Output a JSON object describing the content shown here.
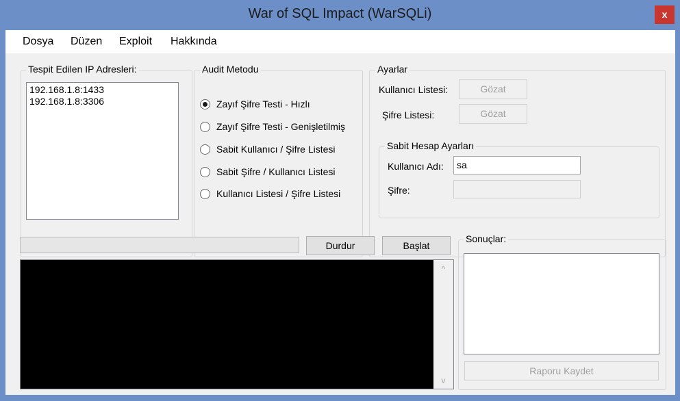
{
  "window": {
    "title": "War of SQL Impact (WarSQLi)",
    "close_glyph": "x"
  },
  "menu": {
    "items": [
      "Dosya",
      "Düzen",
      "Exploit",
      "Hakkında"
    ]
  },
  "ip_group": {
    "label": "Tespit Edilen IP Adresleri:",
    "items": [
      "192.168.1.8:1433",
      "192.168.1.8:3306"
    ]
  },
  "audit": {
    "label": "Audit Metodu",
    "options": [
      {
        "label": "Zayıf Şifre Testi - Hızlı",
        "checked": true
      },
      {
        "label": "Zayıf Şifre Testi - Genişletilmiş",
        "checked": false
      },
      {
        "label": "Sabit Kullanıcı / Şifre Listesi",
        "checked": false
      },
      {
        "label": "Sabit Şifre / Kullanıcı Listesi",
        "checked": false
      },
      {
        "label": "Kullanıcı Listesi / Şifre Listesi",
        "checked": false
      }
    ]
  },
  "settings": {
    "label": "Ayarlar",
    "user_list_label": "Kullanıcı Listesi:",
    "pass_list_label": "Şifre Listesi:",
    "browse_label": "Gözat",
    "fixed": {
      "label": "Sabit Hesap Ayarları",
      "username_label": "Kullanıcı Adı:",
      "username_value": "sa",
      "password_label": "Şifre:",
      "password_value": ""
    }
  },
  "controls": {
    "stop_label": "Durdur",
    "start_label": "Başlat",
    "progress": 0
  },
  "results": {
    "label": "Sonuçlar:",
    "save_label": "Raporu Kaydet"
  },
  "colors": {
    "window_frame": "#6d8fc7",
    "close_button": "#c7372f",
    "console_bg": "#000000"
  }
}
